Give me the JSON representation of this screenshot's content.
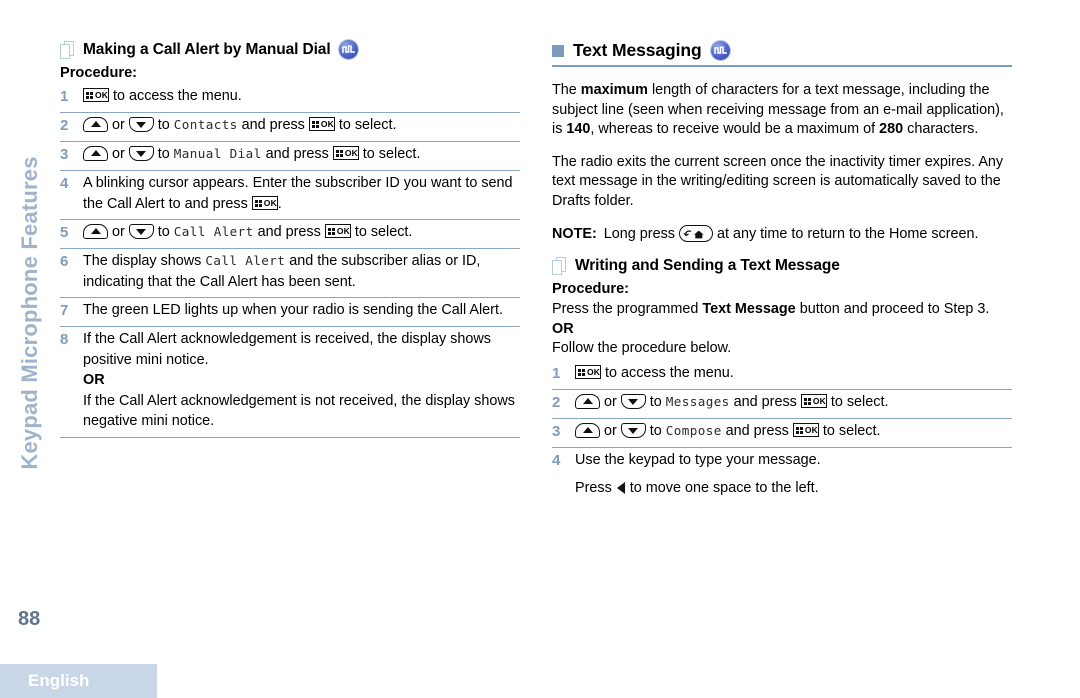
{
  "side_tab": {
    "label": "Keypad Microphone Features"
  },
  "page_number": "88",
  "footer": {
    "language": "English"
  },
  "icons": {
    "pages": "pages-icon",
    "square_bullet": "square-bullet-icon",
    "digital_badge": "digital-badge-icon",
    "menu_ok_key": "menu-ok-key-icon",
    "up_key": "up-arrow-key-icon",
    "down_key": "down-arrow-key-icon",
    "back_home_key": "back-home-key-icon",
    "left_arrow": "left-arrow-icon"
  },
  "colors": {
    "rule": "#7b9bbd",
    "step_number": "#7d9cc0",
    "side_tab_text": "#9fb3cc",
    "footer_bg": "#c9d6e8",
    "page_number": "#60738c"
  },
  "left_column": {
    "heading": "Making a Call Alert by Manual Dial",
    "procedure_label": "Procedure:",
    "steps": [
      {
        "num": "1",
        "parts": [
          {
            "t": "key-ok"
          },
          {
            "t": "text",
            "v": " to access the menu."
          }
        ]
      },
      {
        "num": "2",
        "parts": [
          {
            "t": "key-up"
          },
          {
            "t": "text",
            "v": " or "
          },
          {
            "t": "key-down"
          },
          {
            "t": "text",
            "v": " to "
          },
          {
            "t": "screen",
            "v": "Contacts"
          },
          {
            "t": "text",
            "v": " and press "
          },
          {
            "t": "key-ok"
          },
          {
            "t": "text",
            "v": " to select."
          }
        ]
      },
      {
        "num": "3",
        "parts": [
          {
            "t": "key-up"
          },
          {
            "t": "text",
            "v": " or "
          },
          {
            "t": "key-down"
          },
          {
            "t": "text",
            "v": " to "
          },
          {
            "t": "screen",
            "v": "Manual Dial"
          },
          {
            "t": "text",
            "v": " and press "
          },
          {
            "t": "key-ok"
          },
          {
            "t": "text",
            "v": " to select."
          }
        ]
      },
      {
        "num": "4",
        "parts": [
          {
            "t": "text",
            "v": "A blinking cursor appears. Enter the subscriber ID you want to send the Call Alert to and press "
          },
          {
            "t": "key-ok"
          },
          {
            "t": "text",
            "v": "."
          }
        ]
      },
      {
        "num": "5",
        "parts": [
          {
            "t": "key-up"
          },
          {
            "t": "text",
            "v": " or "
          },
          {
            "t": "key-down"
          },
          {
            "t": "text",
            "v": " to "
          },
          {
            "t": "screen",
            "v": "Call Alert"
          },
          {
            "t": "text",
            "v": " and press "
          },
          {
            "t": "key-ok"
          },
          {
            "t": "text",
            "v": " to select."
          }
        ]
      },
      {
        "num": "6",
        "parts": [
          {
            "t": "text",
            "v": "The display shows "
          },
          {
            "t": "screen",
            "v": "Call Alert"
          },
          {
            "t": "text",
            "v": " and the subscriber alias or ID, indicating that the Call Alert has been sent."
          }
        ]
      },
      {
        "num": "7",
        "parts": [
          {
            "t": "text",
            "v": "The green LED lights up when your radio is sending the Call Alert."
          }
        ]
      },
      {
        "num": "8",
        "parts": [
          {
            "t": "text",
            "v": "If the Call Alert acknowledgement is received, the display shows positive mini notice."
          },
          {
            "t": "break"
          },
          {
            "t": "bold",
            "v": "OR"
          },
          {
            "t": "break"
          },
          {
            "t": "text",
            "v": "If the Call Alert acknowledgement is not received, the display shows negative mini notice."
          }
        ]
      }
    ]
  },
  "right_column": {
    "heading": "Text Messaging",
    "paragraphs": [
      [
        {
          "t": "text",
          "v": "The "
        },
        {
          "t": "bold",
          "v": "maximum"
        },
        {
          "t": "text",
          "v": " length of characters for a text message, including the subject line (seen when receiving message from an e-mail application), is "
        },
        {
          "t": "bold",
          "v": "140"
        },
        {
          "t": "text",
          "v": ", whereas to receive would be a maximum of "
        },
        {
          "t": "bold",
          "v": "280"
        },
        {
          "t": "text",
          "v": " characters."
        }
      ],
      [
        {
          "t": "text",
          "v": "The radio exits the current screen once the inactivity timer expires. Any text message in the writing/editing screen is automatically saved to the Drafts folder."
        }
      ]
    ],
    "note": {
      "label": "NOTE:",
      "parts": [
        {
          "t": "text",
          "v": "Long press "
        },
        {
          "t": "key-home"
        },
        {
          "t": "text",
          "v": " at any time to return to the Home screen."
        }
      ]
    },
    "subsection": {
      "heading": "Writing and Sending a Text Message",
      "procedure_label": "Procedure:",
      "intro": [
        {
          "t": "text",
          "v": "Press the programmed "
        },
        {
          "t": "bold",
          "v": "Text Message"
        },
        {
          "t": "text",
          "v": " button and proceed to Step 3."
        }
      ],
      "or_label": "OR",
      "follow": "Follow the procedure below.",
      "steps": [
        {
          "num": "1",
          "parts": [
            {
              "t": "key-ok"
            },
            {
              "t": "text",
              "v": " to access the menu."
            }
          ]
        },
        {
          "num": "2",
          "parts": [
            {
              "t": "key-up"
            },
            {
              "t": "text",
              "v": " or "
            },
            {
              "t": "key-down"
            },
            {
              "t": "text",
              "v": " to "
            },
            {
              "t": "screen",
              "v": "Messages"
            },
            {
              "t": "text",
              "v": " and press "
            },
            {
              "t": "key-ok"
            },
            {
              "t": "text",
              "v": " to select."
            }
          ]
        },
        {
          "num": "3",
          "parts": [
            {
              "t": "key-up"
            },
            {
              "t": "text",
              "v": " or "
            },
            {
              "t": "key-down"
            },
            {
              "t": "text",
              "v": " to "
            },
            {
              "t": "screen",
              "v": "Compose"
            },
            {
              "t": "text",
              "v": " and press "
            },
            {
              "t": "key-ok"
            },
            {
              "t": "text",
              "v": " to select."
            }
          ]
        },
        {
          "num": "4",
          "parts": [
            {
              "t": "text",
              "v": "Use the keypad to type your message."
            },
            {
              "t": "gap"
            },
            {
              "t": "text",
              "v": "Press "
            },
            {
              "t": "tri-left"
            },
            {
              "t": "text",
              "v": " to move one space to the left."
            }
          ]
        }
      ]
    }
  }
}
